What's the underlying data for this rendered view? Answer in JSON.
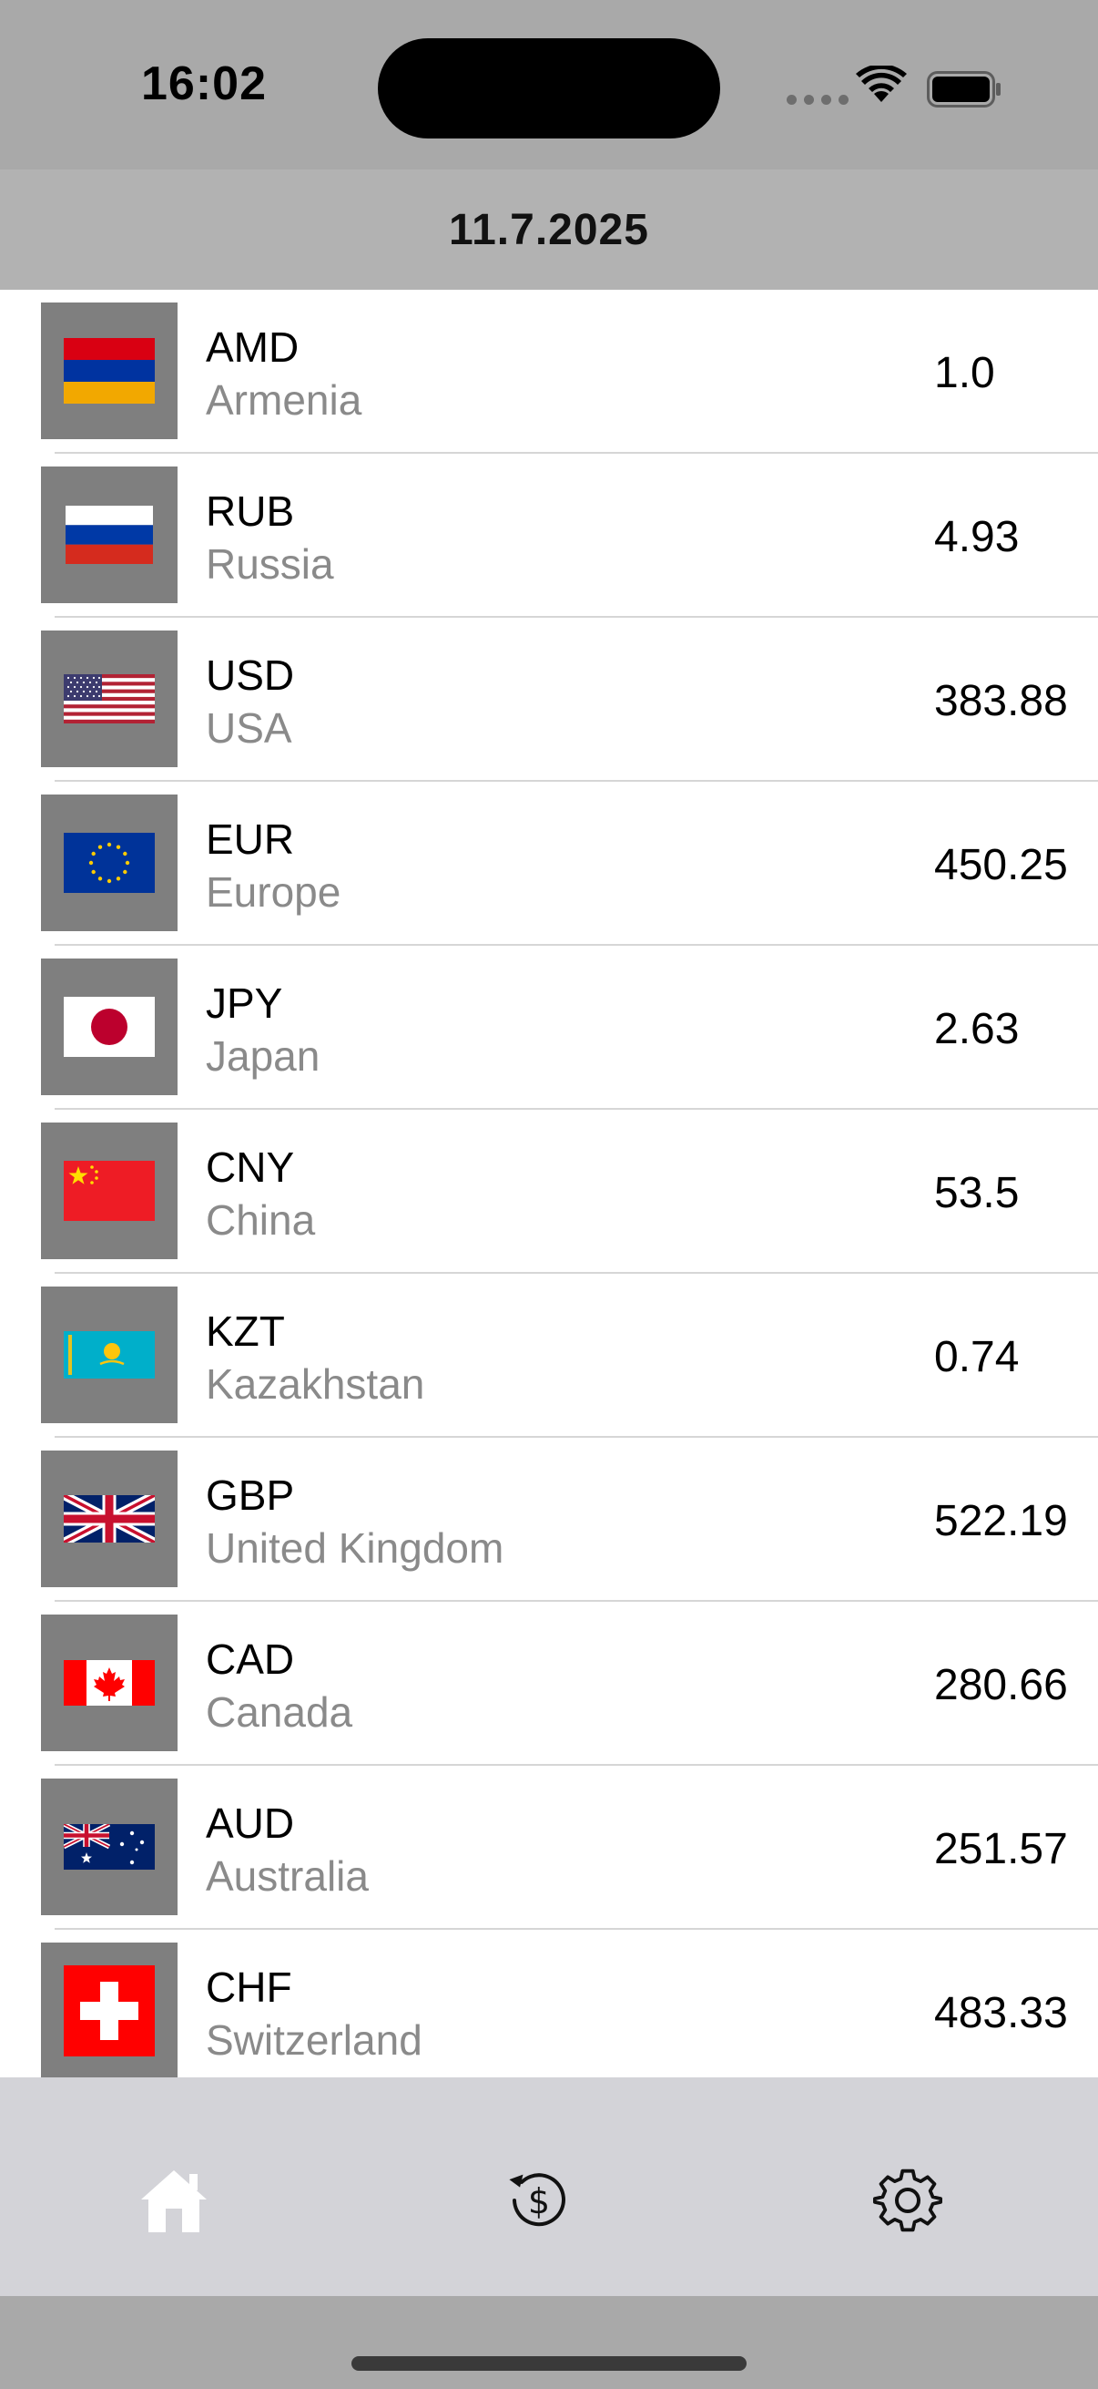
{
  "status_bar": {
    "time": "16:02"
  },
  "header": {
    "title": "11.7.2025"
  },
  "currencies": [
    {
      "code": "AMD",
      "country": "Armenia",
      "rate": "1.0"
    },
    {
      "code": "RUB",
      "country": "Russia",
      "rate": "4.93"
    },
    {
      "code": "USD",
      "country": "USA",
      "rate": "383.88"
    },
    {
      "code": "EUR",
      "country": "Europe",
      "rate": "450.25"
    },
    {
      "code": "JPY",
      "country": "Japan",
      "rate": "2.63"
    },
    {
      "code": "CNY",
      "country": "China",
      "rate": "53.5"
    },
    {
      "code": "KZT",
      "country": "Kazakhstan",
      "rate": "0.74"
    },
    {
      "code": "GBP",
      "country": "United Kingdom",
      "rate": "522.19"
    },
    {
      "code": "CAD",
      "country": "Canada",
      "rate": "280.66"
    },
    {
      "code": "AUD",
      "country": "Australia",
      "rate": "251.57"
    },
    {
      "code": "CHF",
      "country": "Switzerland",
      "rate": "483.33"
    }
  ],
  "tab_bar": {
    "tabs": [
      {
        "icon": "home-icon",
        "active": true
      },
      {
        "icon": "currency-exchange-icon",
        "active": false
      },
      {
        "icon": "gear-icon",
        "active": false
      }
    ]
  },
  "colors": {
    "status_bar_bg": "#a9a9a9",
    "header_bg": "#b2b2b2",
    "flag_box_bg": "#7f7f7f",
    "secondary_text": "#8a8a8a",
    "tab_bar_bg": "#d3d3d8",
    "active_tab": "#ffffff"
  }
}
